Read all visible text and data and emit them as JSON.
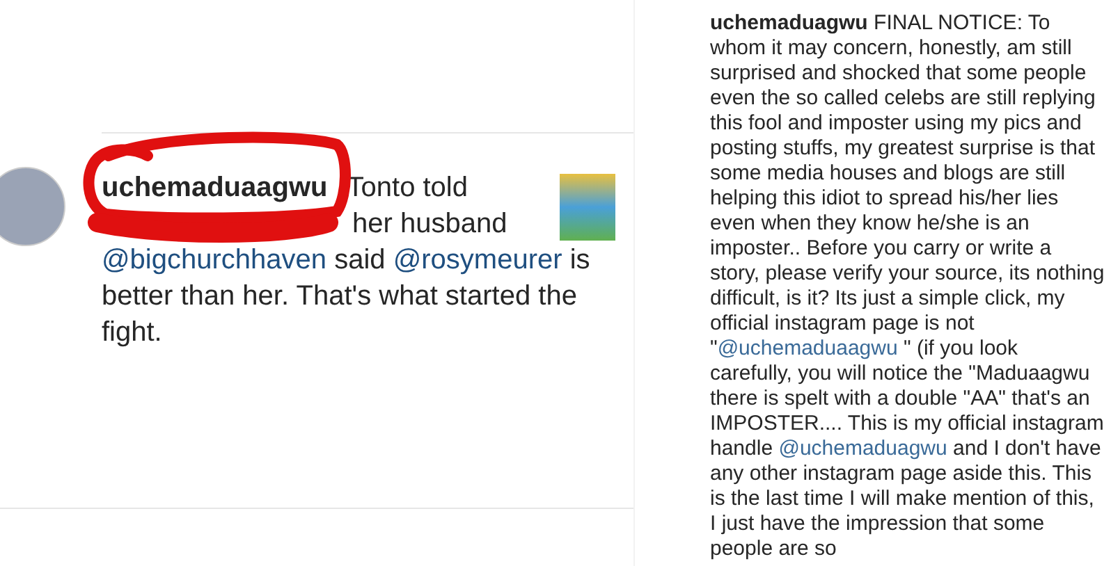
{
  "left_post": {
    "comment": {
      "username": "uchemaduaagwu",
      "lines": [
        {
          "parts": [
            {
              "kind": "text",
              "text": "Tonto told"
            }
          ]
        },
        {
          "parts": [
            {
              "kind": "text",
              "text": "her husband"
            }
          ]
        },
        {
          "parts": [
            {
              "kind": "link",
              "text": "@bigchurchhaven"
            },
            {
              "kind": "text",
              "text": " said "
            },
            {
              "kind": "link",
              "text": "@rosymeurer"
            },
            {
              "kind": "text",
              "text": " is"
            }
          ]
        },
        {
          "parts": [
            {
              "kind": "text",
              "text": "better than her. That's what started the"
            }
          ]
        },
        {
          "parts": [
            {
              "kind": "text",
              "text": "fight."
            }
          ]
        }
      ]
    }
  },
  "right_post": {
    "caption": {
      "username": "uchemaduagwu",
      "parts": [
        {
          "kind": "text",
          "text": " FINAL NOTICE: To whom it may concern, honestly, am still surprised and shocked that some people even the so called celebs are still replying this fool and imposter using my pics and posting stuffs, my greatest surprise is that some media houses and blogs are still helping this idiot to spread his/her lies even when they know he/she is an imposter.. Before you carry or write a story, please verify your source, its nothing difficult, is it? Its just a simple click, my official instagram page is not \""
        },
        {
          "kind": "link",
          "text": "@uchemaduaagwu"
        },
        {
          "kind": "text",
          "text": " \" (if you look carefully, you will notice the \"Maduaagwu there is spelt with a double \"AA\" that's an IMPOSTER.... This is my official instagram handle "
        },
        {
          "kind": "link",
          "text": "@uchemaduagwu"
        },
        {
          "kind": "text",
          "text": " and I don't have any other instagram page aside this. This is the last time I will make mention of this, I just have the impression that some people are so"
        }
      ]
    }
  }
}
